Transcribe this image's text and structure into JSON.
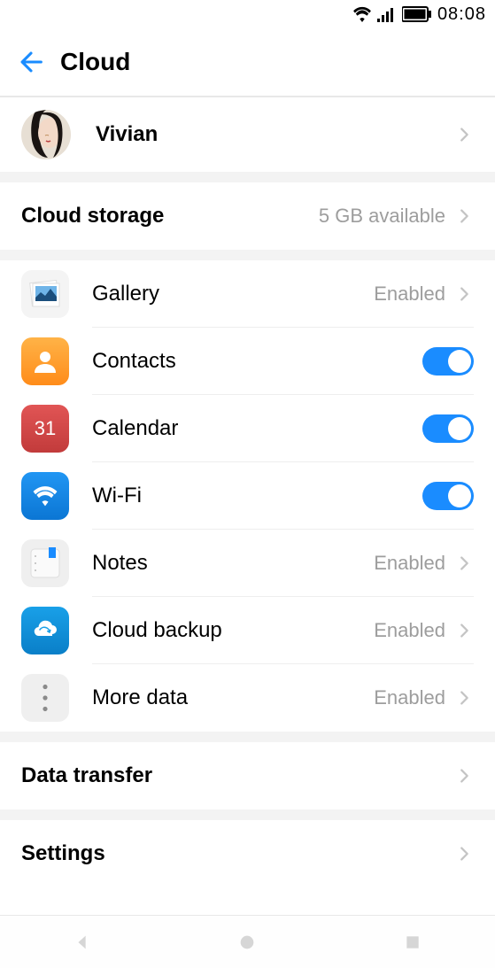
{
  "status": {
    "time": "08:08"
  },
  "header": {
    "title": "Cloud"
  },
  "profile": {
    "name": "Vivian"
  },
  "storage": {
    "label": "Cloud storage",
    "available": "5 GB  available"
  },
  "services": {
    "gallery": {
      "label": "Gallery",
      "status": "Enabled"
    },
    "contacts": {
      "label": "Contacts"
    },
    "calendar": {
      "label": "Calendar"
    },
    "wifi": {
      "label": "Wi-Fi"
    },
    "notes": {
      "label": "Notes",
      "status": "Enabled"
    },
    "cloud_backup": {
      "label": "Cloud backup",
      "status": "Enabled"
    },
    "more_data": {
      "label": "More data",
      "status": "Enabled"
    }
  },
  "links": {
    "data_transfer": "Data transfer",
    "settings": "Settings"
  }
}
